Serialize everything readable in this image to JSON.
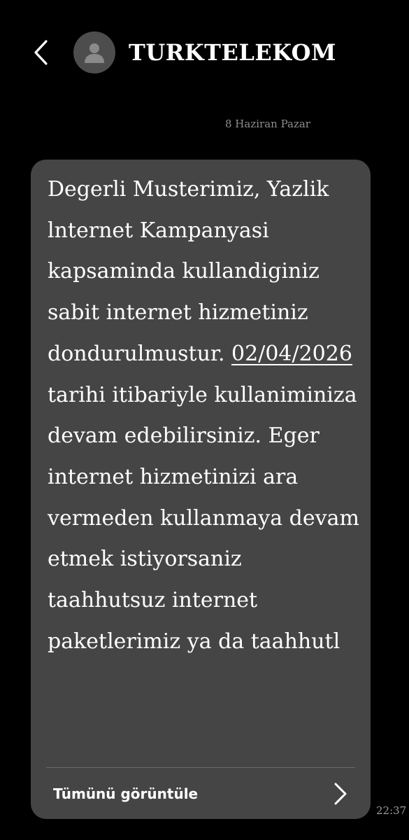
{
  "header": {
    "contact_name": "TURKTELEKOM",
    "back_icon": "chevron-left-icon",
    "avatar_icon": "person-icon"
  },
  "conversation": {
    "date": "8 Haziran Pazar",
    "message": {
      "text_before_link": "Degerli Musterimiz, Yazlik lnternet Kampanyasi kapsaminda kullandiginiz sabit internet hizmetiniz dondurulmustur. ",
      "date_link": "02/04/2026",
      "text_after_link": " tarihi itibariyle kullaniminiza devam edebilirsiniz. Eger internet hizmetinizi ara vermeden kullanmaya devam etmek istiyorsaniz taahhutsuz internet paketlerimiz ya da taahhutl",
      "view_all_label": "Tümünü görüntüle",
      "view_all_icon": "chevron-right-icon",
      "time": "22:37"
    }
  },
  "colors": {
    "background": "#000000",
    "bubble": "#454545",
    "avatar": "#4d4d4d",
    "secondary_text": "#8e8e8e"
  }
}
